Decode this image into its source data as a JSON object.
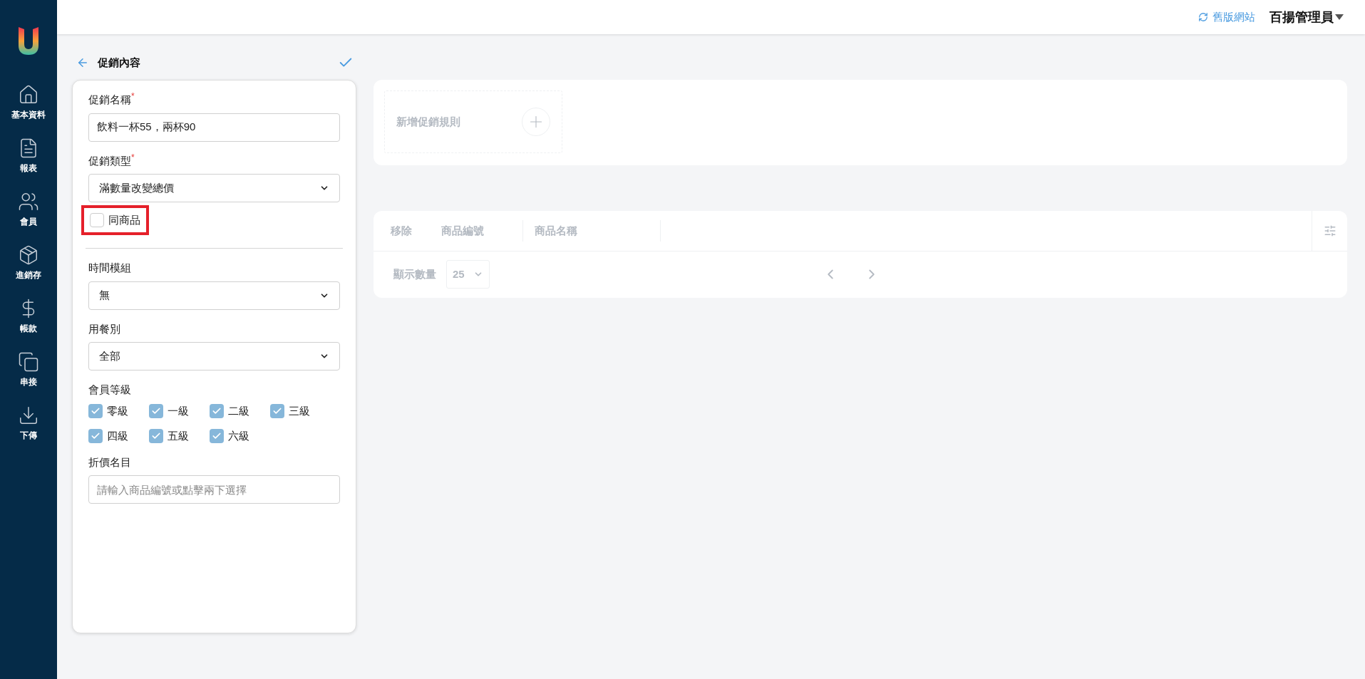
{
  "header": {
    "legacy_link": "舊版網站",
    "user": "百揚管理員"
  },
  "sidebar": {
    "items": [
      {
        "label": "基本資料"
      },
      {
        "label": "報表"
      },
      {
        "label": "會員"
      },
      {
        "label": "進銷存"
      },
      {
        "label": "帳款"
      },
      {
        "label": "串接"
      },
      {
        "label": "下傳"
      }
    ]
  },
  "form": {
    "title": "促銷內容",
    "promo_name": {
      "label": "促銷名稱",
      "required_mark": "*",
      "value": "飲料一杯55，兩杯90"
    },
    "promo_type": {
      "label": "促銷類型",
      "required_mark": "*",
      "value": "滿數量改變總價"
    },
    "same_product": {
      "label": "同商品",
      "checked": false,
      "highlighted": true
    },
    "time_module": {
      "label": "時間模組",
      "value": "無"
    },
    "meal_type": {
      "label": "用餐別",
      "value": "全部"
    },
    "member_levels": {
      "label": "會員等級",
      "options": [
        {
          "label": "零級",
          "checked": true
        },
        {
          "label": "一級",
          "checked": true
        },
        {
          "label": "二級",
          "checked": true
        },
        {
          "label": "三級",
          "checked": true
        },
        {
          "label": "四級",
          "checked": true
        },
        {
          "label": "五級",
          "checked": true
        },
        {
          "label": "六級",
          "checked": true
        }
      ]
    },
    "discount_items": {
      "label": "折價名目",
      "placeholder": "請輸入商品編號或點擊兩下選擇"
    }
  },
  "rules_panel": {
    "disabled": true,
    "add_rule": "新增促銷規則",
    "table": {
      "columns": [
        "移除",
        "商品編號",
        "商品名稱"
      ],
      "page_size_label": "顯示數量",
      "page_size": "25"
    }
  }
}
